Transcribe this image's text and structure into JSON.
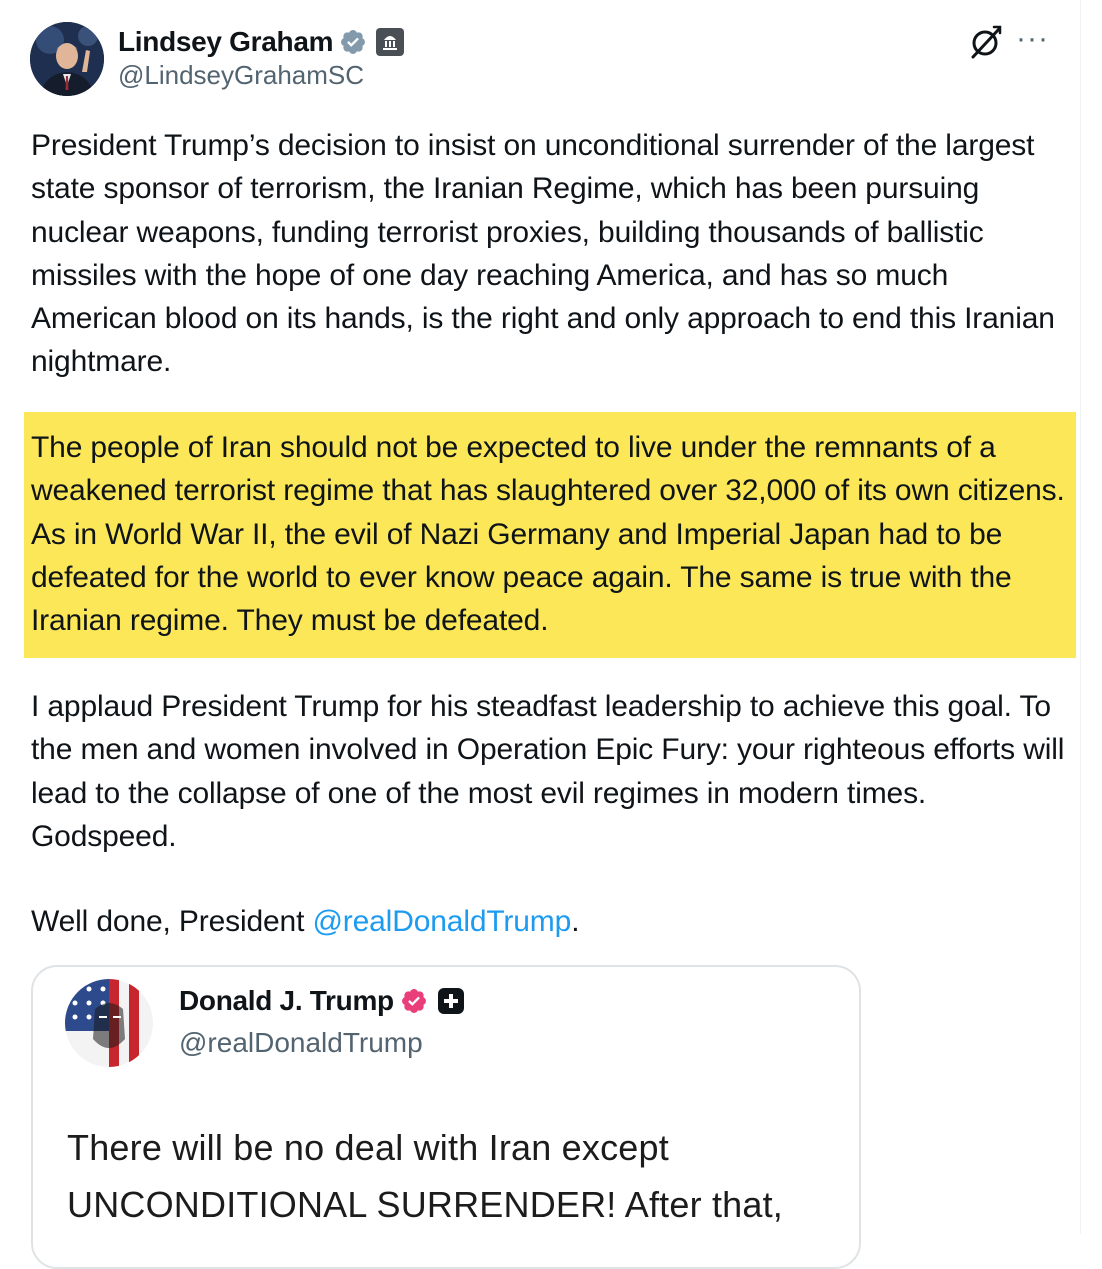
{
  "author": {
    "name": "Lindsey Graham",
    "handle": "@LindseyGrahamSC",
    "verified_color": "#829aab"
  },
  "icons": {
    "verified": "verified-badge-icon",
    "affiliation": "government-building-icon",
    "grok": "grok-icon",
    "more": "more-options-icon"
  },
  "more_label": "···",
  "paragraphs": {
    "p1": "President Trump’s decision to insist on unconditional surrender of the largest state sponsor of terrorism, the Iranian Regime, which has been pursuing nuclear weapons, funding terrorist proxies, building thousands of ballistic missiles with the hope of one day reaching America, and has so much American blood on its hands, is the right and only approach to end this Iranian nightmare.",
    "p2_highlighted": "The people of Iran should not be expected to live under the remnants of a weakened terrorist regime that has slaughtered over 32,000 of its own citizens. As in World War II, the evil of Nazi Germany and Imperial Japan had to be defeated for the world to ever know peace again. The same is true with the Iranian regime. They must be defeated.",
    "p3": "I applaud President Trump for his steadfast leadership to achieve this goal. To the men and women involved in Operation Epic Fury: your righteous efforts will lead to the collapse of one of the most evil regimes in modern times. Godspeed.",
    "p4_prefix": "Well done, President ",
    "p4_mention": "@realDonaldTrump",
    "p4_suffix": "."
  },
  "highlight_color": "#fbe758",
  "mention_color": "#1d9bf0",
  "quote": {
    "name": "Donald J. Trump",
    "handle": "@realDonaldTrump",
    "verified_color": "#ea3e7a",
    "text": "There will be no deal with Iran except UNCONDITIONAL SURRENDER! After that,"
  }
}
